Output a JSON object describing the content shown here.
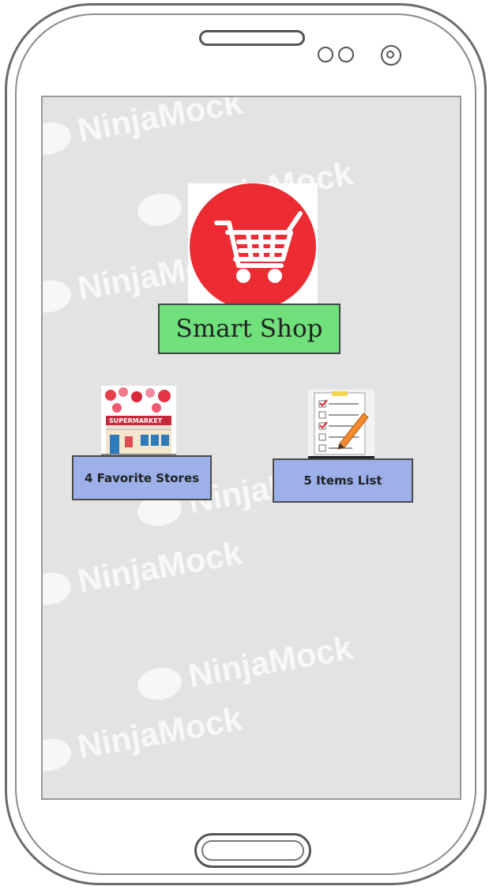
{
  "app": {
    "title": "Smart Shop"
  },
  "home": {
    "stores_button_label": "4 Favorite Stores",
    "items_button_label": "5 Items List",
    "store_sign_text": "SUPERMARKET"
  },
  "watermark": {
    "text": "NinjaMock"
  },
  "colors": {
    "screen_background": "#e3e3e3",
    "logo_red": "#ec2b33",
    "title_green": "#6fe07a",
    "tile_blue": "#9db0ea"
  },
  "icons": {
    "logo": "shopping-cart-icon",
    "stores": "supermarket-storefront-icon",
    "items": "checklist-with-pencil-icon"
  }
}
